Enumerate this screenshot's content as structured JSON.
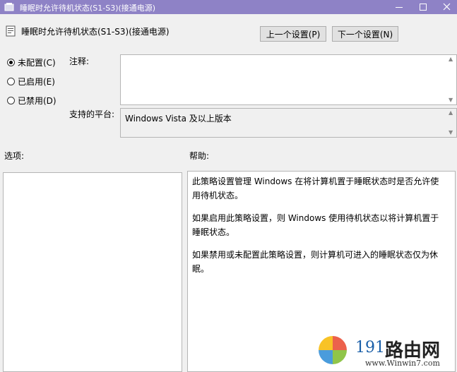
{
  "window": {
    "title": "睡眠时允许待机状态(S1-S3)(接通电源)"
  },
  "header": {
    "policy_title": "睡眠时允许待机状态(S1-S3)(接通电源)",
    "prev_button": "上一个设置(P)",
    "next_button": "下一个设置(N)"
  },
  "state_options": [
    {
      "label": "未配置(C)",
      "checked": true
    },
    {
      "label": "已启用(E)",
      "checked": false
    },
    {
      "label": "已禁用(D)",
      "checked": false
    }
  ],
  "comment": {
    "label": "注释:",
    "value": ""
  },
  "platform": {
    "label": "支持的平台:",
    "value": "Windows Vista 及以上版本"
  },
  "options": {
    "label": "选项:"
  },
  "help": {
    "label": "帮助:",
    "paragraphs": [
      "此策略设置管理 Windows 在将计算机置于睡眠状态时是否允许使用待机状态。",
      "如果启用此策略设置，则 Windows 使用待机状态以将计算机置于睡眠状态。",
      "如果禁用或未配置此策略设置，则计算机可进入的睡眠状态仅为休眠。"
    ]
  },
  "watermark": {
    "number": "191",
    "text": "路由网",
    "url": "www.Winwin7.com"
  },
  "colors": {
    "titlebar": "#8e82c6",
    "background": "#f0f0f0"
  }
}
